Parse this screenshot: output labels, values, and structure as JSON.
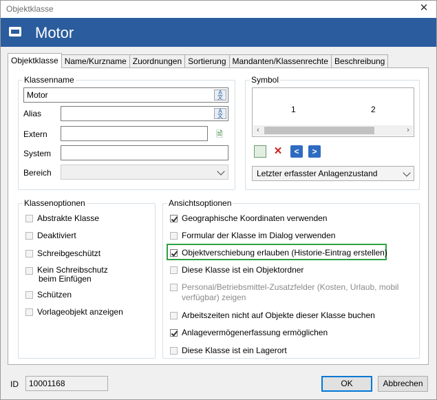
{
  "window": {
    "title": "Objektklasse"
  },
  "header": {
    "title": "Motor"
  },
  "tabs": [
    {
      "label": "Objektklasse",
      "active": true
    },
    {
      "label": "Name/Kurzname"
    },
    {
      "label": "Zuordnungen"
    },
    {
      "label": "Sortierung"
    },
    {
      "label": "Mandanten/Klassenrechte"
    },
    {
      "label": "Beschreibung"
    }
  ],
  "klassenname": {
    "group_label": "Klassenname",
    "value": "Motor",
    "alias_label": "Alias",
    "alias_value": "",
    "extern_label": "Extern",
    "extern_value": "",
    "system_label": "System",
    "system_value": "",
    "bereich_label": "Bereich",
    "bereich_value": ""
  },
  "symbol": {
    "group_label": "Symbol",
    "cells": [
      "1",
      "2"
    ],
    "dropdown_value": "Letzter erfasster Anlagenzustand"
  },
  "klassenoptionen": {
    "group_label": "Klassenoptionen",
    "items": [
      {
        "label": "Abstrakte Klasse",
        "checked": false
      },
      {
        "label": "Deaktiviert",
        "checked": false
      },
      {
        "label": "Schreibgeschützt",
        "checked": false
      },
      {
        "label": "Kein Schreibschutz",
        "label2": "beim Einfügen",
        "checked": false
      },
      {
        "label": "Schützen",
        "checked": false
      },
      {
        "label": "Vorlageobjekt anzeigen",
        "checked": false
      }
    ]
  },
  "ansichtsoptionen": {
    "group_label": "Ansichtsoptionen",
    "items": [
      {
        "label": "Geographische Koordinaten verwenden",
        "checked": true
      },
      {
        "label": "Formular der Klasse im Dialog verwenden",
        "checked": false
      },
      {
        "label": "Objektverschiebung erlauben (Historie-Eintrag erstellen)",
        "checked": true,
        "highlighted": true
      },
      {
        "label": "Diese Klasse ist ein Objektordner",
        "checked": false
      },
      {
        "label": "Personal/Betriebsmittel-Zusatzfelder (Kosten, Urlaub, mobil",
        "label2": "verfügbar) zeigen",
        "checked": false,
        "disabled": true
      },
      {
        "label": "Arbeitszeiten nicht auf Objekte dieser Klasse buchen",
        "checked": false
      },
      {
        "label": "Anlagevermögenerfassung ermöglichen",
        "checked": true
      },
      {
        "label": "Diese Klasse ist ein Lagerort",
        "checked": false
      }
    ]
  },
  "footer": {
    "id_label": "ID",
    "id_value": "10001168",
    "ok_label": "OK",
    "cancel_label": "Abbrechen"
  },
  "colors": {
    "header_bg": "#2a5c9e",
    "highlight": "#2ea043"
  },
  "icons": {
    "window_close": "close-icon",
    "header": "object-class-icon",
    "translate": "translate-icon",
    "extern_refresh": "document-refresh-icon",
    "symbol_add": "add-image-icon",
    "symbol_delete": "delete-icon",
    "symbol_prev": "arrow-left-icon",
    "symbol_next": "arrow-right-icon"
  }
}
